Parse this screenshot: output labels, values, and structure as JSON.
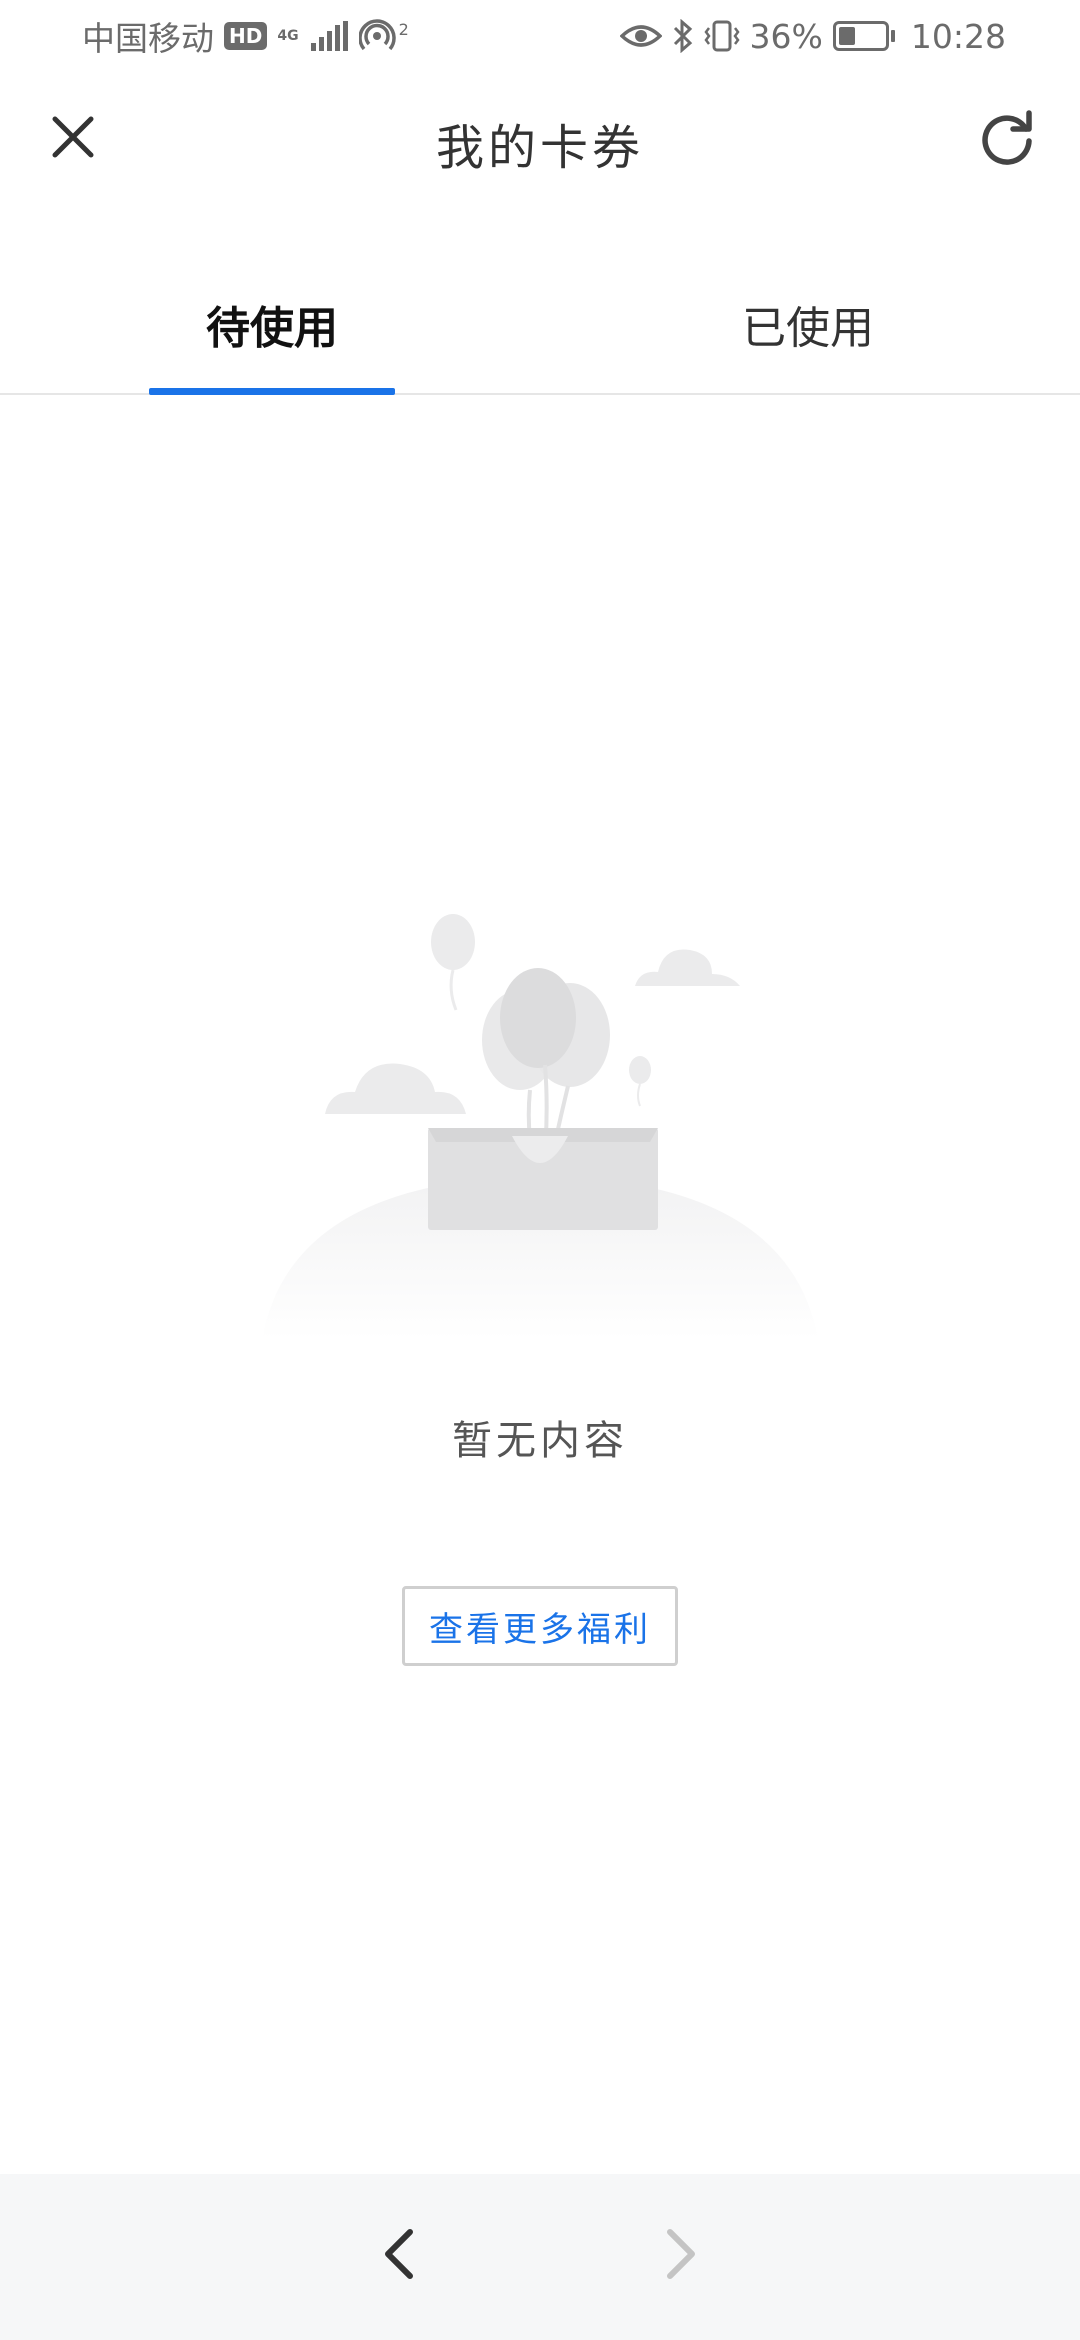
{
  "status_bar": {
    "carrier": "中国移动",
    "hd_badge": "HD",
    "network": "4G",
    "signal_icon": "signal-bars-icon",
    "hotspot_icon": "hotspot-icon",
    "hotspot_count": "2",
    "eye_icon": "eye-comfort-icon",
    "bluetooth_icon": "bluetooth-icon",
    "vibrate_icon": "vibrate-icon",
    "battery_percent": "36%",
    "battery_level": 0.36,
    "time": "10:28"
  },
  "header": {
    "title": "我的卡券",
    "close_icon": "close-icon",
    "refresh_icon": "refresh-icon"
  },
  "tabs": [
    {
      "label": "待使用",
      "active": true
    },
    {
      "label": "已使用",
      "active": false
    }
  ],
  "accent_color": "#1a73e8",
  "empty_state": {
    "illustration": "empty-box-balloons-illustration",
    "message": "暂无内容",
    "button_label": "查看更多福利"
  },
  "bottom_nav": {
    "back_icon": "chevron-left-icon",
    "forward_icon": "chevron-right-icon",
    "forward_enabled": false
  }
}
